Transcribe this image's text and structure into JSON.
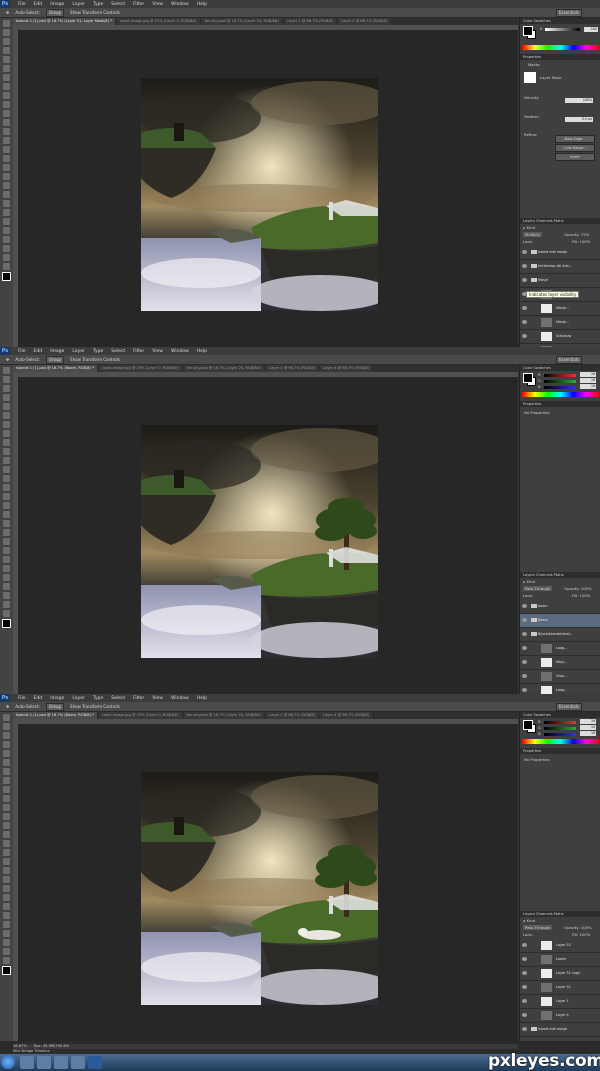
{
  "menu": [
    "File",
    "Edit",
    "Image",
    "Layer",
    "Type",
    "Select",
    "Filter",
    "View",
    "Window",
    "Help"
  ],
  "app_logo": "Ps",
  "options": {
    "auto_select": "Auto-Select:",
    "auto_select_value": "Group",
    "transform": "Show Transform Controls"
  },
  "workspace": "Essentials",
  "shots": [
    {
      "tabs": [
        "Islands 1 (1).psd @ 16.7% (Layer 51, Layer Mask/8) *",
        "coast-image.jpg @ 25% (Layer 0, RGB/8#)",
        "the-tiny.psd @ 16.7% (Layer 24, RGB/8#)",
        "Layer 1 @ 66.7% (RGB/8)",
        "Layer 4 @ 66.7% (RGB/8)"
      ],
      "panel_top": "Color  Swatches",
      "properties_tab": "Properties",
      "mask_title": "Masks",
      "mask_sub": "Layer Mask",
      "density": "Density:",
      "density_val": "100%",
      "feather": "Feather:",
      "feather_val": "0.0 px",
      "refine": "Refine:",
      "btn1": "Mask Edge...",
      "btn2": "Color Range...",
      "btn3": "Invert",
      "layers_tab": "Layers  Channels  Paths",
      "blend": "Multiply",
      "opacity": "Opacity: 72%",
      "fill": "Fill: 100%",
      "lock": "Lock:",
      "tooltip": "Indicates layer visibility",
      "layers": [
        {
          "label": "Island met mesje",
          "grp": true
        },
        {
          "label": "hertenkop stil 4da...",
          "grp": true
        },
        {
          "label": "Masje",
          "grp": true
        },
        {
          "label": "Masje..."
        },
        {
          "label": "Masje..."
        },
        {
          "label": "Masje..."
        },
        {
          "label": "Schaduw"
        },
        {
          "label": "Schaduw"
        }
      ]
    },
    {
      "tabs": [
        "Islands 1 (1).psd @ 16.7% (Boom, RGB/8) *",
        "coast-image.jpg @ 25% (Layer 0, RGB/8#)",
        "the-tiny.psd @ 16.7% (Layer 24, RGB/8#)",
        "Layer 1 @ 66.7% (RGB/8)",
        "Layer 4 @ 66.7% (RGB/8)"
      ],
      "panel_top": "Color  Swatches",
      "r": "R",
      "g": "G",
      "b": "B",
      "rv": "19",
      "gv": "19",
      "bv": "19",
      "properties_tab": "Properties",
      "noprops": "No Properties",
      "layers_tab": "Layers  Channels  Paths",
      "blend": "Pass Through",
      "opacity": "Opacity: 100%",
      "fill": "Fill: 100%",
      "lock": "Lock:",
      "layers": [
        {
          "label": "boom",
          "grp": true
        },
        {
          "label": "Boom",
          "grp": true,
          "sel": true
        },
        {
          "label": "Bijschikkende/stad...",
          "grp": true
        },
        {
          "label": "Laag..."
        },
        {
          "label": "Masj..."
        },
        {
          "label": "Grou..."
        },
        {
          "label": "Laag..."
        },
        {
          "label": "Layer 37"
        }
      ]
    },
    {
      "tabs": [
        "Islands 1 (1).psd @ 16.7% (Boom, RGB/8) *",
        "coast-image.jpg @ 25% (Layer 0, RGB/8#)",
        "the-tiny.psd @ 16.7% (Layer 24, RGB/8#)",
        "Layer 1 @ 66.7% (RGB/8)",
        "Layer 4 @ 66.7% (RGB/8)"
      ],
      "panel_top": "Color  Swatches",
      "r": "R",
      "g": "G",
      "b": "B",
      "rv": "19",
      "gv": "19",
      "bv": "19",
      "properties_tab": "Properties",
      "noprops": "No Properties",
      "layers_tab": "Layers  Channels  Paths",
      "blend": "Pass Through",
      "opacity": "Opacity: 100%",
      "fill": "Fill: 100%",
      "lock": "Lock:",
      "layers": [
        {
          "label": "Layer 52"
        },
        {
          "label": "Laaim"
        },
        {
          "label": "Layer 51 copy"
        },
        {
          "label": "Layer 51"
        },
        {
          "label": "Layer 1"
        },
        {
          "label": "Layer 4"
        },
        {
          "label": "Island met mesje",
          "grp": true
        },
        {
          "label": "hertenkop stil 4da...",
          "grp": true
        },
        {
          "label": "Masje",
          "grp": true
        }
      ]
    }
  ],
  "status": {
    "zoom": "16.67%",
    "doc": "Doc: 45.9M/795.4M"
  },
  "minibridge": "Mini Bridge   Timeline",
  "watermark": "pxleyes.com",
  "colors": {
    "panel": "#3f3f3f",
    "canvas": "#272727",
    "accent": "#1a3a66"
  }
}
